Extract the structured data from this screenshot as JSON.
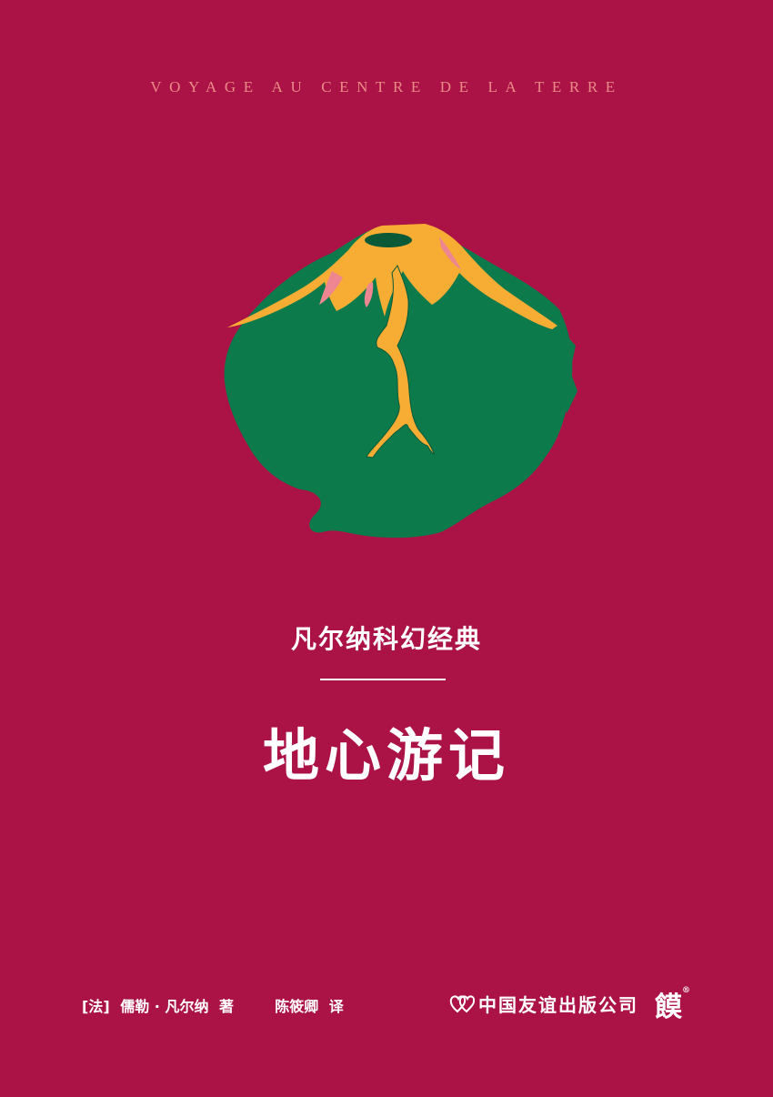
{
  "cover": {
    "background_color": "#ab1246",
    "series_title_en": "VOYAGE AU CENTRE DE LA TERRE",
    "series_name_cn": "凡尔纳科幻经典",
    "book_title": "地心游记",
    "illustration": {
      "name": "volcano-illustration",
      "colors": {
        "mountain": "#0d7a4c",
        "lava": "#f7ad34",
        "lava_pink": "#ee8692",
        "crater": "#0a5a38"
      }
    },
    "credits": {
      "origin": "[法]",
      "author": "儒勒 · 凡尔纳",
      "author_role": "著",
      "translator": "陈筱卿",
      "translator_role": "译"
    },
    "publisher": {
      "name": "中国友谊出版公司",
      "logo_icon": "double-heart-logo-icon"
    },
    "imprint": {
      "text": "饃",
      "registered_mark": "®"
    }
  }
}
